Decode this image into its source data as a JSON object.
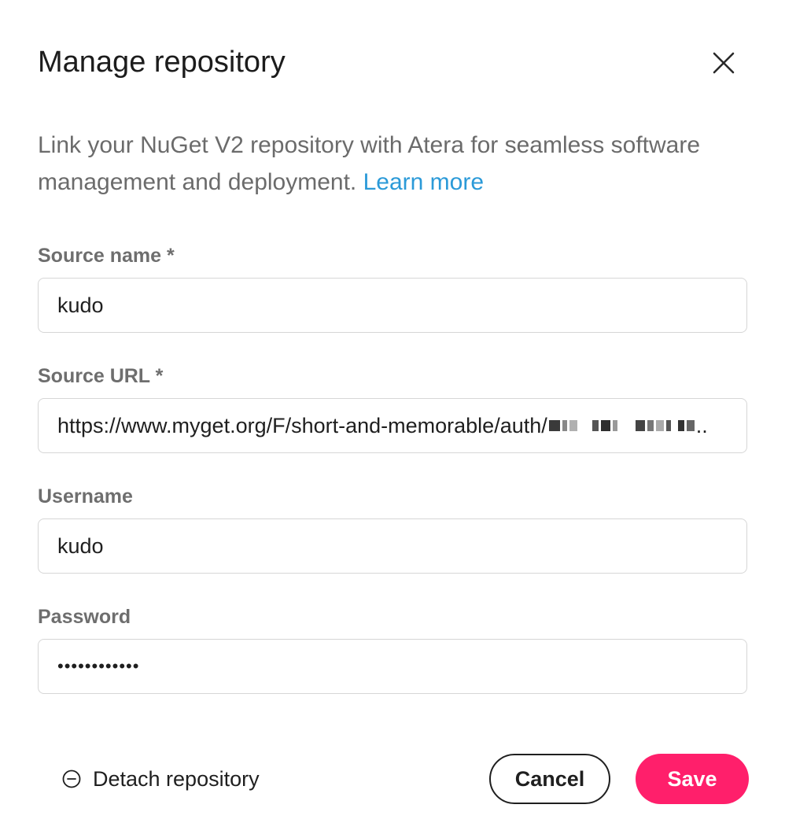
{
  "dialog": {
    "title": "Manage repository",
    "description": "Link your NuGet V2 repository with Atera for seamless software management and deployment.",
    "learn_more": "Learn more"
  },
  "fields": {
    "source_name": {
      "label": "Source name *",
      "value": "kudo"
    },
    "source_url": {
      "label": "Source URL *",
      "value": "https://www.myget.org/F/short-and-memorable/auth/"
    },
    "username": {
      "label": "Username",
      "value": "kudo"
    },
    "password": {
      "label": "Password",
      "value": "••••••••••••"
    }
  },
  "footer": {
    "detach_label": "Detach repository",
    "cancel_label": "Cancel",
    "save_label": "Save"
  },
  "icons": {
    "close": "close-icon",
    "detach": "minus-circle-icon"
  },
  "colors": {
    "accent_link": "#2b9ad8",
    "save_button": "#ff1f6b",
    "label_gray": "#6e6e6e",
    "border": "#d6d6d6"
  }
}
